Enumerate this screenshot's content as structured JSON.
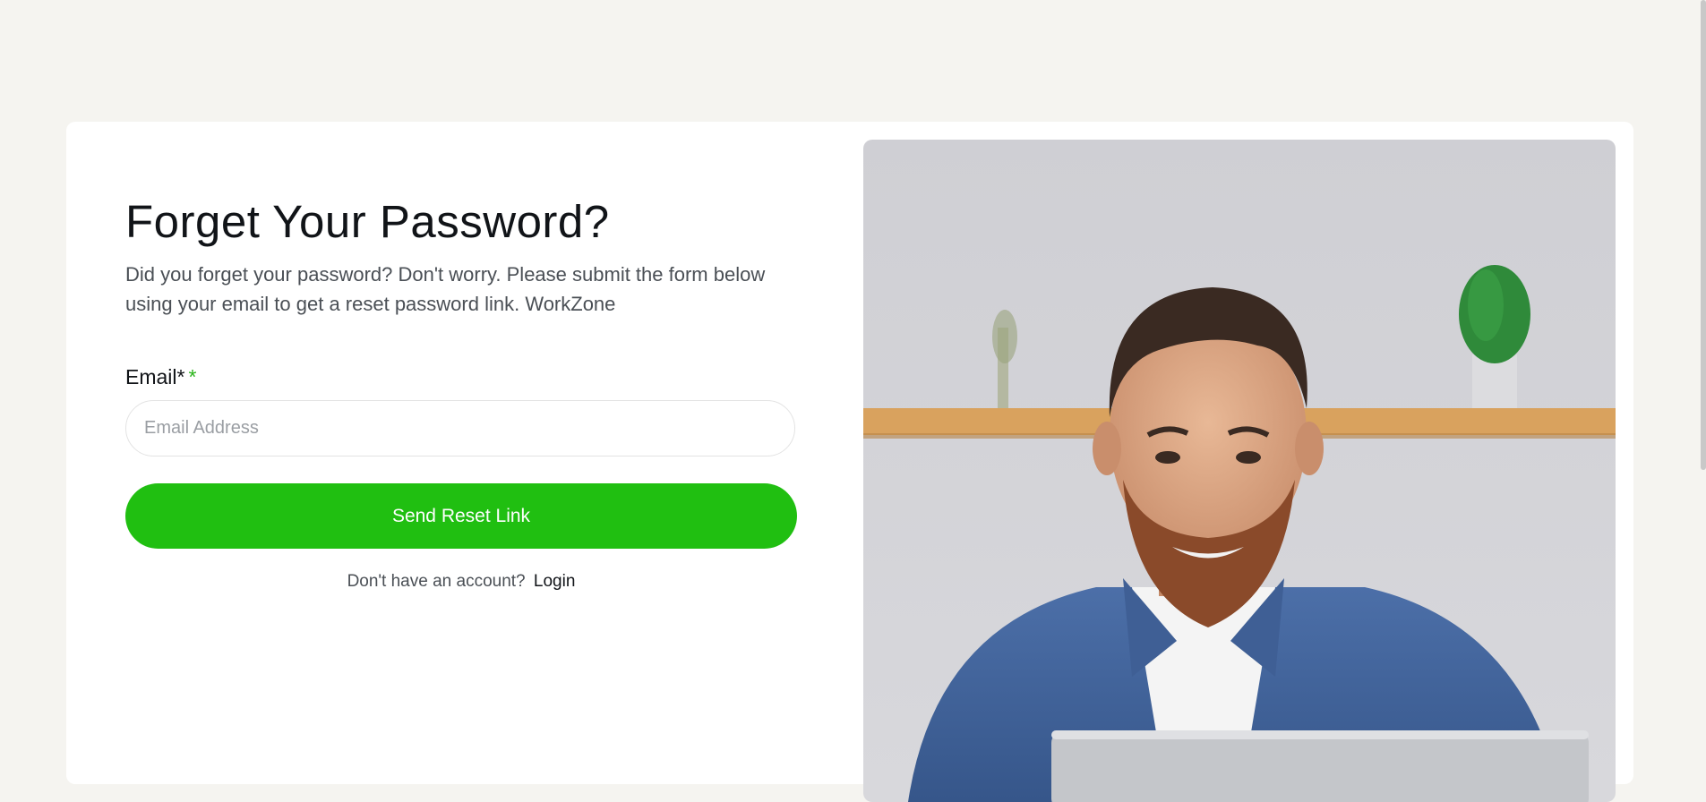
{
  "page": {
    "title": "Forget Your Password?",
    "subtitle": "Did you forget your password? Don't worry. Please submit the form below using your email to get a reset password link. WorkZone"
  },
  "form": {
    "email_label": "Email*",
    "required_mark": "*",
    "email_value": "",
    "email_placeholder": "Email Address",
    "submit_label": "Send Reset Link"
  },
  "footer": {
    "prompt": "Don't have an account?",
    "login_link": "Login"
  },
  "colors": {
    "accent": "#20bf11",
    "background": "#f5f4f0",
    "card": "#ffffff",
    "heading": "#111418"
  },
  "image": {
    "subject": "smiling-man-photo"
  }
}
